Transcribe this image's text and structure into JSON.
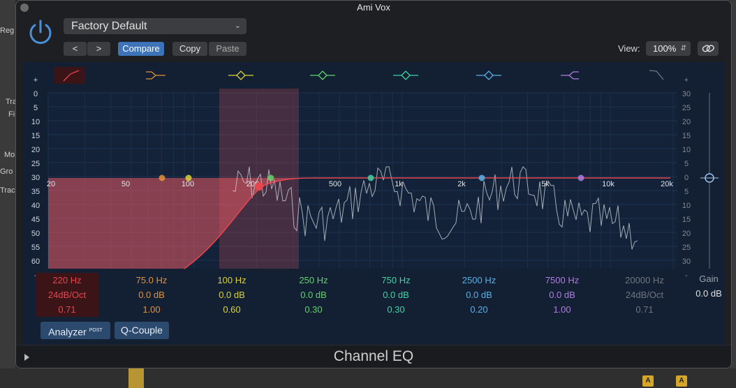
{
  "app": {
    "window_title": "Ami Vox",
    "plugin_name": "Channel EQ"
  },
  "background": {
    "left_labels": [
      "Reg",
      "Tra",
      "Fi",
      "Mo",
      "Gro",
      "Trac"
    ]
  },
  "header": {
    "preset": "Factory Default",
    "prev_label": "<",
    "next_label": ">",
    "compare_label": "Compare",
    "copy_label": "Copy",
    "paste_label": "Paste",
    "view_label": "View:",
    "view_value": "100%"
  },
  "scale_left": [
    "+",
    "0",
    "5",
    "10",
    "15",
    "20",
    "25",
    "30",
    "35",
    "40",
    "45",
    "50",
    "55",
    "60",
    "-"
  ],
  "scale_right": [
    "+",
    "30",
    "25",
    "20",
    "15",
    "10",
    "5",
    "0",
    "5",
    "10",
    "15",
    "20",
    "25",
    "30",
    "-"
  ],
  "freq_labels": [
    "20",
    "50",
    "100",
    "200",
    "500",
    "1k",
    "2k",
    "5k",
    "10k",
    "20k"
  ],
  "bands": [
    {
      "freq": "220 Hz",
      "gain": "24dB/Oct",
      "q": "0.71",
      "color": "#e8464f",
      "type": "lowcut"
    },
    {
      "freq": "75.0 Hz",
      "gain": "0.0 dB",
      "q": "1.00",
      "color": "#e0923a",
      "type": "lowshelf"
    },
    {
      "freq": "100 Hz",
      "gain": "0.0 dB",
      "q": "0.60",
      "color": "#d9d23a",
      "type": "bell"
    },
    {
      "freq": "250 Hz",
      "gain": "0.0 dB",
      "q": "0.30",
      "color": "#5fd46a",
      "type": "bell"
    },
    {
      "freq": "750 Hz",
      "gain": "0.0 dB",
      "q": "0.30",
      "color": "#3fd4a4",
      "type": "bell"
    },
    {
      "freq": "2500 Hz",
      "gain": "0.0 dB",
      "q": "0.20",
      "color": "#5ab0e8",
      "type": "bell"
    },
    {
      "freq": "7500 Hz",
      "gain": "0.0 dB",
      "q": "1.00",
      "color": "#b07de0",
      "type": "highshelf"
    },
    {
      "freq": "20000 Hz",
      "gain": "24dB/Oct",
      "q": "0.71",
      "color": "#6f7680",
      "type": "highcut"
    }
  ],
  "gain": {
    "label": "Gain",
    "value": "0.0 dB"
  },
  "buttons": {
    "analyzer": "Analyzer",
    "analyzer_badge": "POST",
    "qcouple": "Q-Couple"
  },
  "track_buttons": {
    "a_label": "A"
  }
}
